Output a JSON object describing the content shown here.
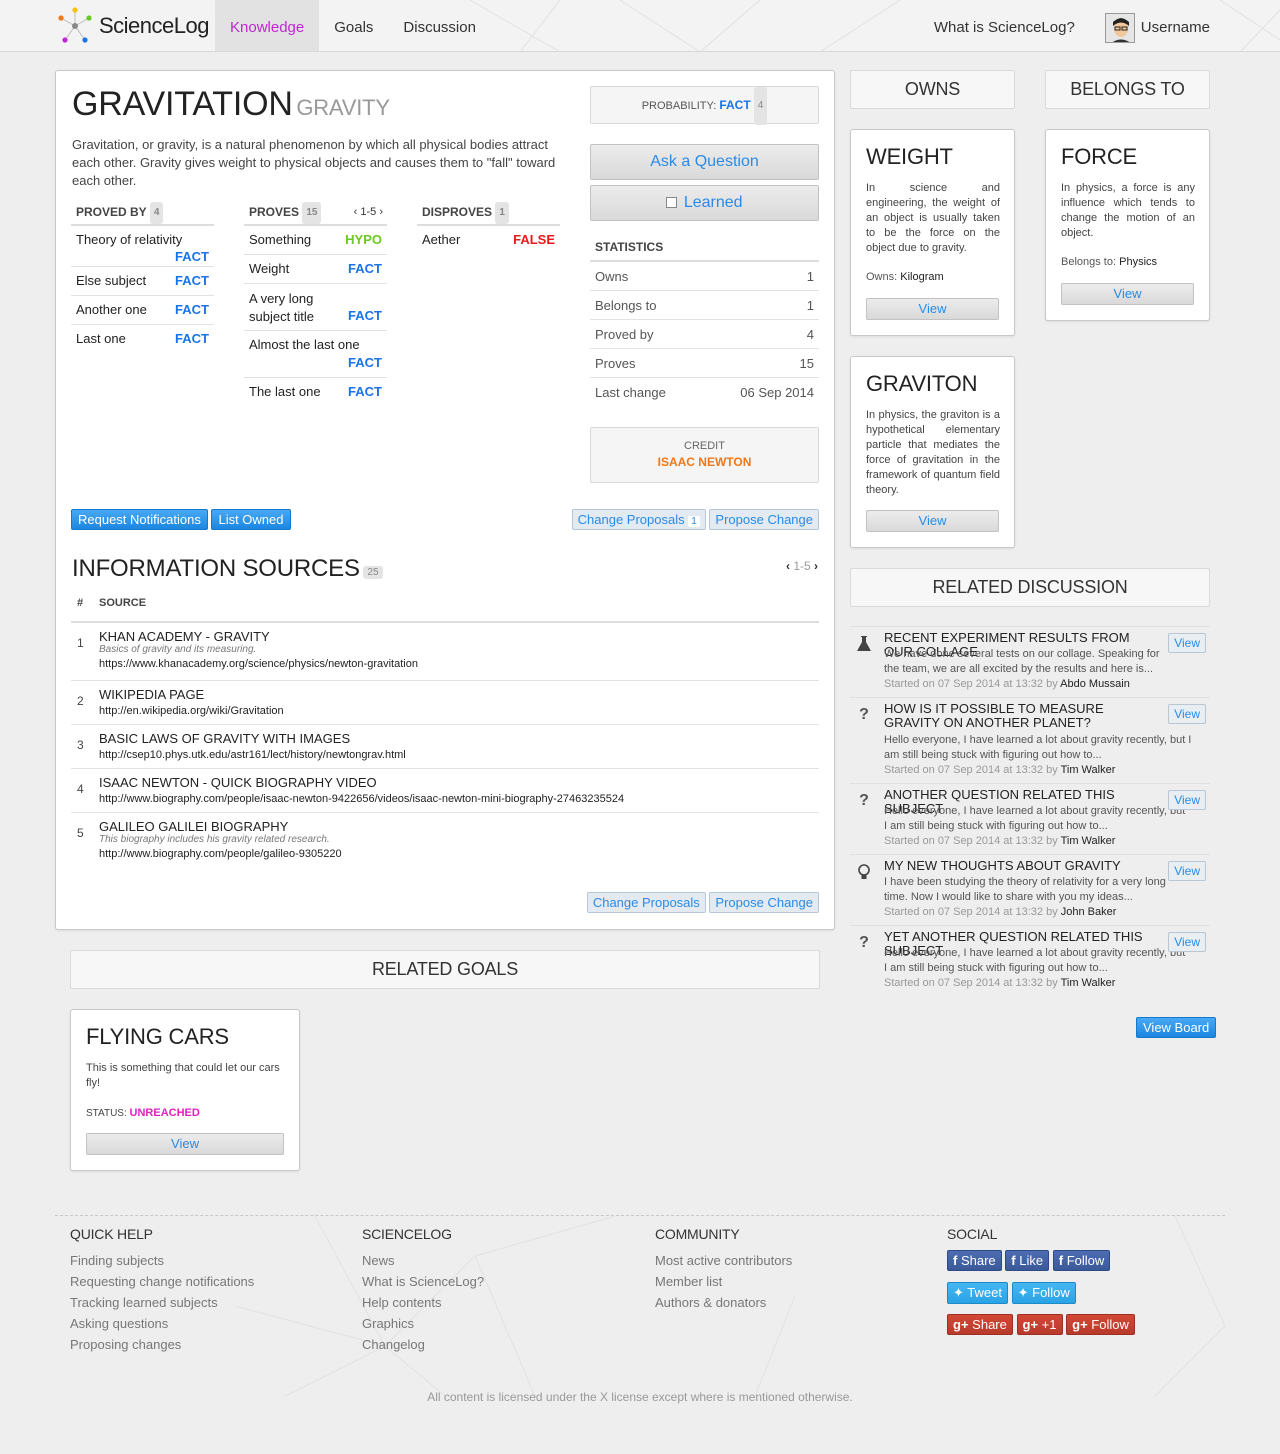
{
  "nav": {
    "logo": "ScienceLog",
    "items": [
      "Knowledge",
      "Goals",
      "Discussion"
    ],
    "what_is": "What is ScienceLog?",
    "username": "Username"
  },
  "subject": {
    "title": "GRAVITATION",
    "alias": "GRAVITY",
    "description": "Gravitation, or gravity, is a natural phenomenon by which all physical bodies attract each other. Gravity gives weight to physical objects and causes them to \"fall\" toward each other.",
    "probability_label": "PROBABILITY:",
    "probability_value": "FACT",
    "probability_count": "4",
    "ask_question": "Ask a Question",
    "learned": "Learned",
    "proved_by": {
      "label": "PROVED BY",
      "count": "4",
      "items": [
        {
          "name": "Theory of relativity",
          "status": "FACT"
        },
        {
          "name": "Else subject",
          "status": "FACT"
        },
        {
          "name": "Another one",
          "status": "FACT"
        },
        {
          "name": "Last one",
          "status": "FACT"
        }
      ]
    },
    "proves": {
      "label": "PROVES",
      "count": "15",
      "pager": "1-5",
      "items": [
        {
          "name": "Something",
          "status": "HYPO"
        },
        {
          "name": "Weight",
          "status": "FACT"
        },
        {
          "name": "A very long subject title",
          "status": "FACT"
        },
        {
          "name": "Almost the last one",
          "status": "FACT"
        },
        {
          "name": "The last one",
          "status": "FACT"
        }
      ]
    },
    "disproves": {
      "label": "DISPROVES",
      "count": "1",
      "items": [
        {
          "name": "Aether",
          "status": "FALSE"
        }
      ]
    },
    "statistics": {
      "label": "STATISTICS",
      "rows": [
        {
          "label": "Owns",
          "value": "1"
        },
        {
          "label": "Belongs to",
          "value": "1"
        },
        {
          "label": "Proved by",
          "value": "4"
        },
        {
          "label": "Proves",
          "value": "15"
        },
        {
          "label": "Last change",
          "value": "06 Sep 2014"
        }
      ]
    },
    "credit_label": "CREDIT",
    "credit_name": "ISAAC NEWTON",
    "buttons": {
      "request_notifications": "Request Notifications",
      "list_owned": "List Owned",
      "change_proposals": "Change Proposals",
      "change_proposals_count": "1",
      "propose_change": "Propose Change"
    }
  },
  "sources": {
    "title": "INFORMATION SOURCES",
    "count": "25",
    "pager": "1-5",
    "col_num": "#",
    "col_source": "SOURCE",
    "items": [
      {
        "num": "1",
        "title": "KHAN ACADEMY - GRAVITY",
        "desc": "Basics of gravity and its measuring.",
        "url": "https://www.khanacademy.org/science/physics/newton-gravitation"
      },
      {
        "num": "2",
        "title": "WIKIPEDIA PAGE",
        "desc": "",
        "url": "http://en.wikipedia.org/wiki/Gravitation"
      },
      {
        "num": "3",
        "title": "BASIC LAWS OF GRAVITY WITH IMAGES",
        "desc": "",
        "url": "http://csep10.phys.utk.edu/astr161/lect/history/newtongrav.html"
      },
      {
        "num": "4",
        "title": "ISAAC NEWTON - QUICK BIOGRAPHY VIDEO",
        "desc": "",
        "url": "http://www.biography.com/people/isaac-newton-9422656/videos/isaac-newton-mini-biography-27463235524"
      },
      {
        "num": "5",
        "title": "GALILEO GALILEI BIOGRAPHY",
        "desc": "This biography includes his gravity related research.",
        "url": "http://www.biography.com/people/galileo-9305220"
      }
    ],
    "change_proposals": "Change Proposals",
    "propose_change": "Propose Change"
  },
  "owns": {
    "title": "OWNS",
    "cards": [
      {
        "title": "WEIGHT",
        "text": "In science and engineering, the weight of an object is usually taken to be the force on the object due to gravity.",
        "meta_label": "Owns:",
        "meta_value": "Kilogram",
        "view": "View"
      },
      {
        "title": "GRAVITON",
        "text": "In physics, the graviton is a hypothetical elementary particle that mediates the force of gravitation in the framework of quantum field theory.",
        "meta_label": "",
        "meta_value": "",
        "view": "View"
      }
    ]
  },
  "belongs": {
    "title": "BELONGS TO",
    "cards": [
      {
        "title": "FORCE",
        "text": "In physics, a force is any influence which tends to change the motion of an object.",
        "meta_label": "Belongs to:",
        "meta_value": "Physics",
        "view": "View"
      }
    ]
  },
  "discussion": {
    "title": "RELATED DISCUSSION",
    "view_board": "View Board",
    "items": [
      {
        "icon": "flask-icon",
        "title": "RECENT EXPERIMENT RESULTS FROM OUR COLLAGE",
        "text": "We have done several tests on our collage. Speaking for the team, we are all excited by the results and here is...",
        "meta": "Started on 07 Sep 2014 at 13:32 by",
        "author": "Abdo Mussain",
        "view": "View"
      },
      {
        "icon": "question-icon",
        "title": "HOW IS IT POSSIBLE TO MEASURE GRAVITY ON ANOTHER PLANET?",
        "text": "Hello everyone, I have learned a lot about gravity recently, but I am still being stuck with figuring out how to...",
        "meta": "Started on 07 Sep 2014 at 13:32 by",
        "author": "Tim Walker",
        "view": "View"
      },
      {
        "icon": "question-icon",
        "title": "ANOTHER QUESTION RELATED THIS SUBJECT",
        "text": "Hello everyone, I have learned a lot about gravity recently, but I am still being stuck with figuring out how to...",
        "meta": "Started on 07 Sep 2014 at 13:32 by",
        "author": "Tim Walker",
        "view": "View"
      },
      {
        "icon": "lightbulb-icon",
        "title": "MY NEW THOUGHTS ABOUT GRAVITY",
        "text": "I have been studying the theory of relativity for a very long time. Now I would like to share with you my ideas...",
        "meta": "Started on 07 Sep 2014 at 13:32 by",
        "author": "John Baker",
        "view": "View"
      },
      {
        "icon": "question-icon",
        "title": "YET ANOTHER QUESTION RELATED THIS SUBJECT",
        "text": "Hello everyone, I have learned a lot about gravity recently, but I am still being stuck with figuring out how to...",
        "meta": "Started on 07 Sep 2014 at 13:32 by",
        "author": "Tim Walker",
        "view": "View"
      }
    ]
  },
  "goals": {
    "title": "RELATED GOALS",
    "card_title": "FLYING CARS",
    "card_text": "This is something that could let our cars fly!",
    "status_label": "STATUS:",
    "status_value": "UNREACHED",
    "view": "View"
  },
  "footer": {
    "quick_help": {
      "title": "QUICK HELP",
      "links": [
        "Finding subjects",
        "Requesting change notifications",
        "Tracking learned subjects",
        "Asking questions",
        "Proposing changes"
      ]
    },
    "sciencelog": {
      "title": "SCIENCELOG",
      "links": [
        "News",
        "What is ScienceLog?",
        "Help contents",
        "Graphics",
        "Changelog"
      ]
    },
    "community": {
      "title": "COMMUNITY",
      "links": [
        "Most active contributors",
        "Member list",
        "Authors & donators"
      ]
    },
    "social": {
      "title": "SOCIAL",
      "facebook": [
        "Share",
        "Like",
        "Follow"
      ],
      "twitter": [
        "Tweet",
        "Follow"
      ],
      "gplus": [
        "Share",
        "+1",
        "Follow"
      ]
    },
    "license": "All content is licensed under the X license except where is mentioned otherwise."
  },
  "colors": {
    "accent": "#c026d3",
    "fact": "#1a73e8",
    "hypo": "#6bc91f",
    "false": "#e81a1a",
    "credit": "#f07818",
    "unreached": "#e21fc0"
  }
}
